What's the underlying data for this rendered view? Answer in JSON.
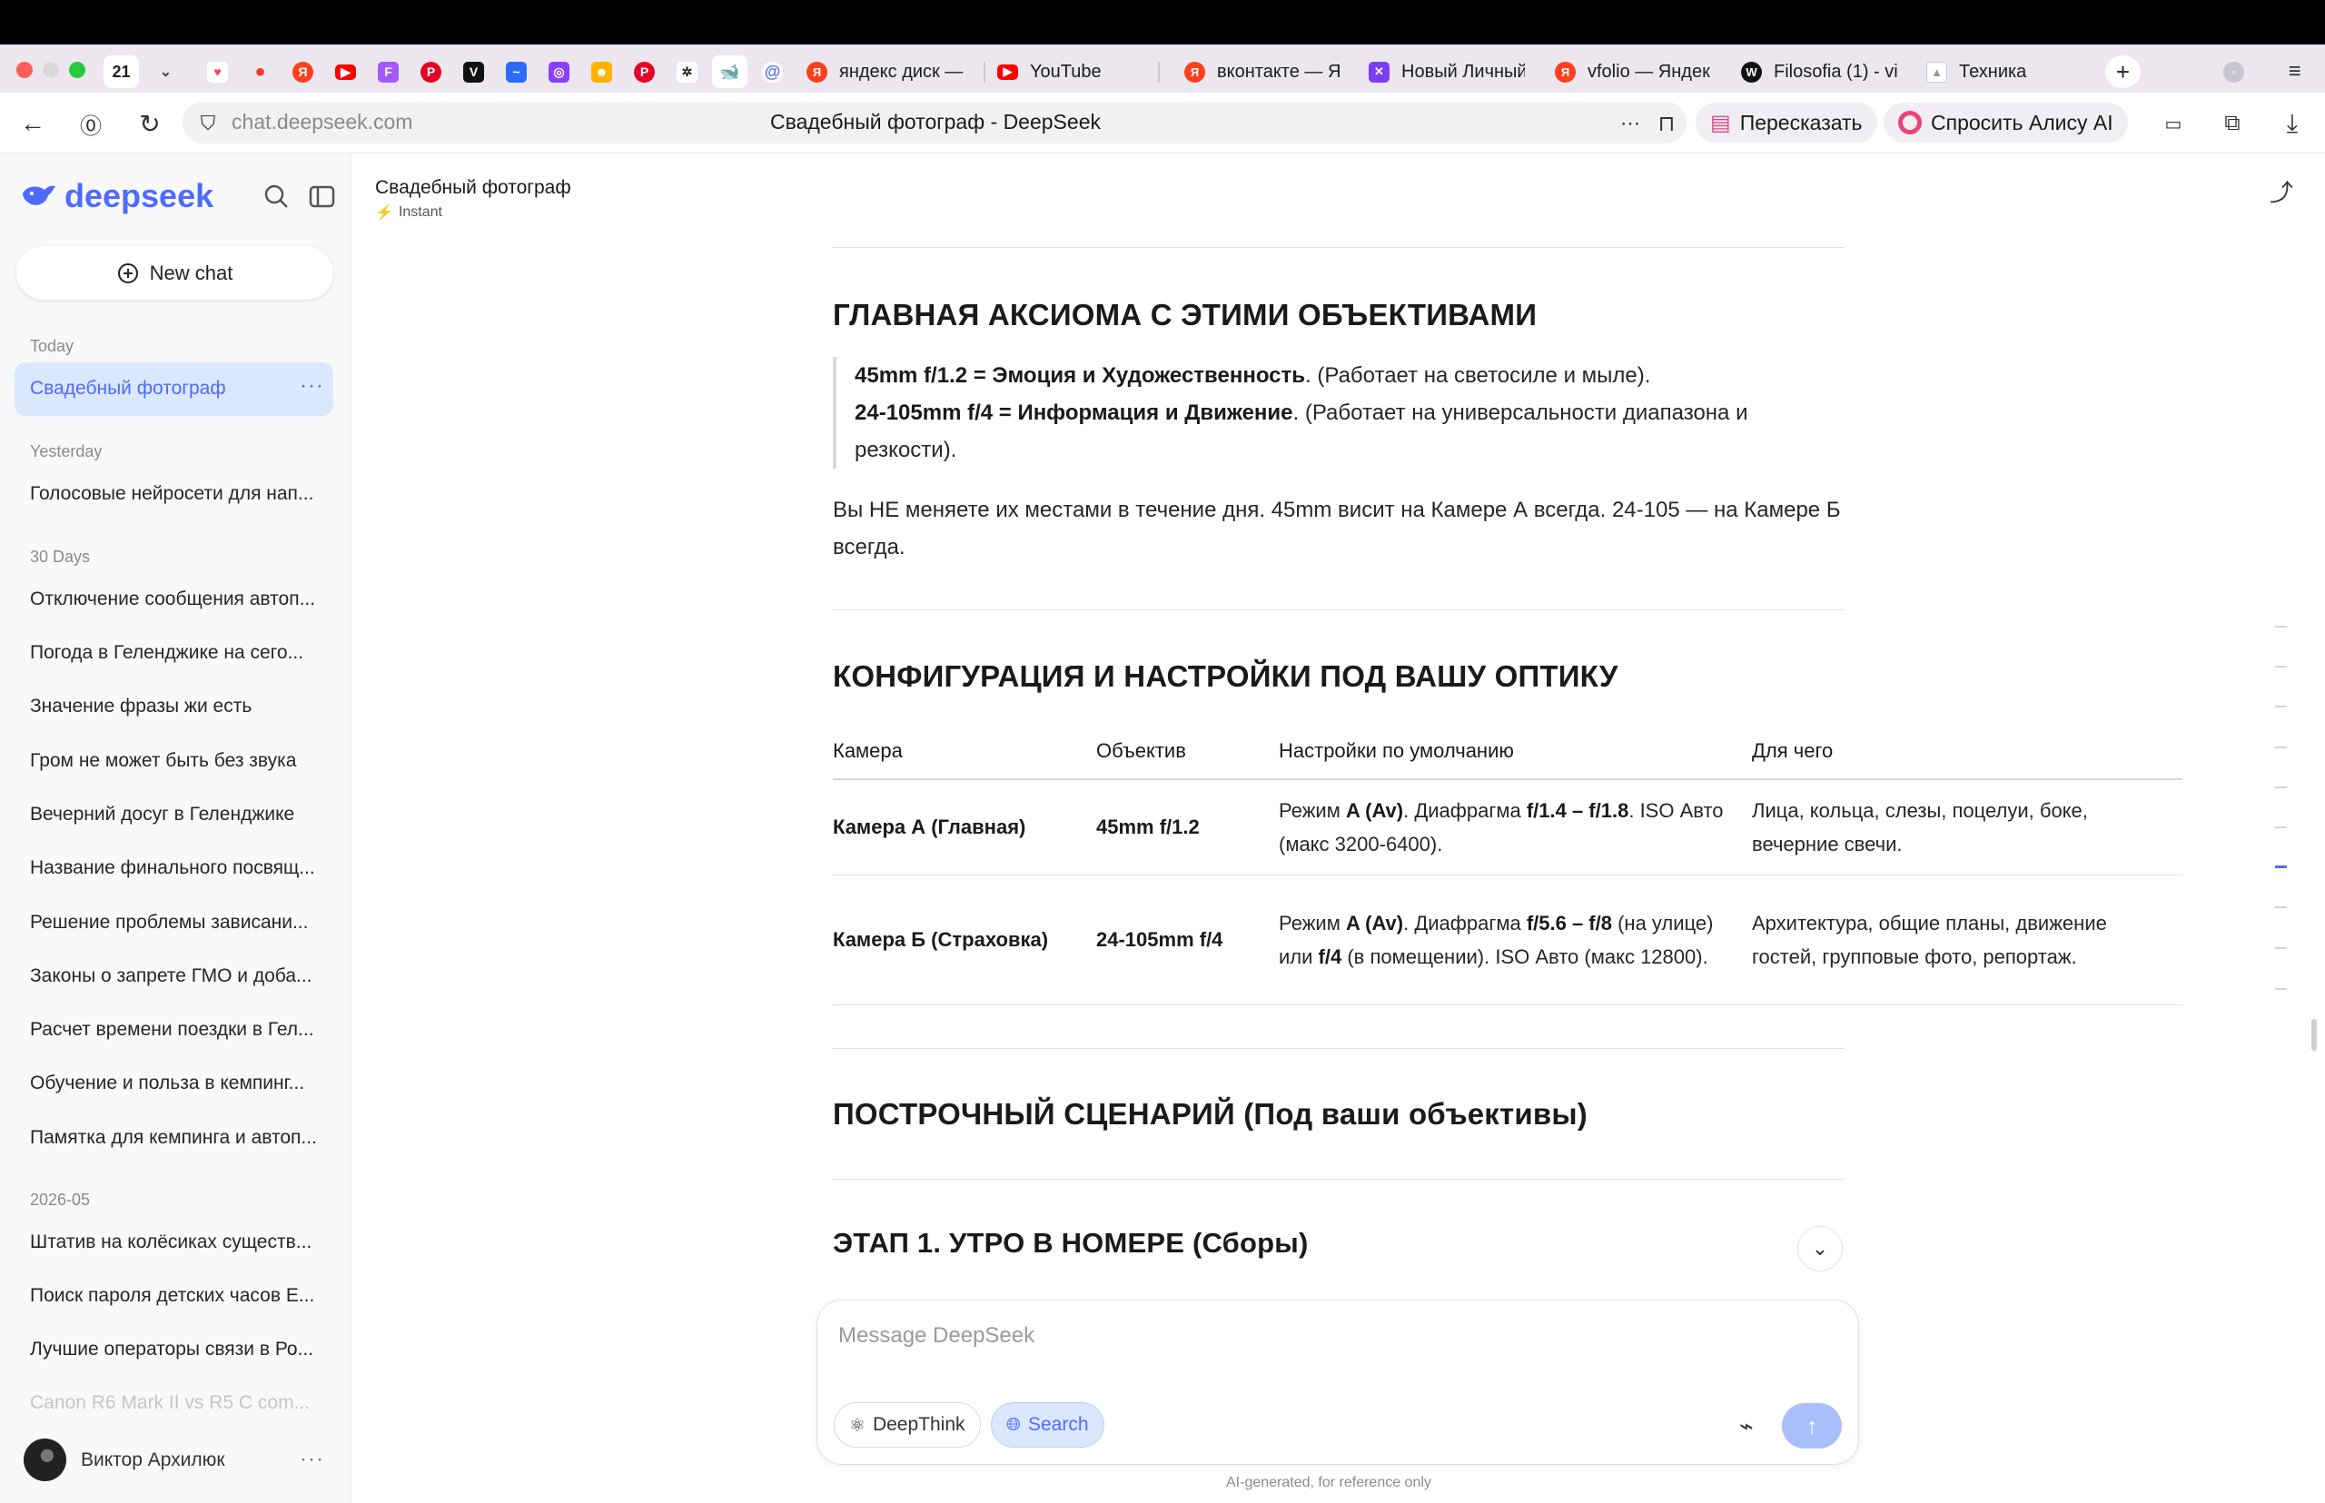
{
  "browser": {
    "tab_counter": "21",
    "url": "chat.deepseek.com",
    "page_title": "Свадебный фотограф - DeepSeek",
    "retell_button": "Пересказать",
    "alice_button": "Спросить Алису AI",
    "tabs": [
      {
        "label": "яндекс диск —",
        "icon": "yandex-icon"
      },
      {
        "label": "YouTube",
        "icon": "youtube-icon"
      },
      {
        "label": "вконтакте — Я",
        "icon": "yandex-icon"
      },
      {
        "label": "Новый Личный",
        "icon": "app-icon"
      },
      {
        "label": "vfolio — Яндекс",
        "icon": "yandex-icon"
      },
      {
        "label": "Filosofia (1) - vi",
        "icon": "w-icon"
      },
      {
        "label": "Техника",
        "icon": "page-icon"
      }
    ]
  },
  "sidebar": {
    "brand": "deepseek",
    "new_chat": "New chat",
    "today_label": "Today",
    "today_items": [
      "Свадебный фотограф"
    ],
    "yesterday_label": "Yesterday",
    "yesterday_items": [
      "Голосовые нейросети для нап..."
    ],
    "days30_label": "30 Days",
    "days30_items": [
      "Отключение сообщения автоп...",
      "Погода в Геленджике на сего...",
      "Значение фразы жи есть",
      "Гром не может быть без звука",
      "Вечерний досуг в Геленджике",
      "Название финального посвящ...",
      "Решение проблемы зависани...",
      "Законы о запрете ГМО и доба...",
      "Расчет времени поездки в Гел...",
      "Обучение и польза в кемпинг...",
      "Памятка для кемпинга и автоп..."
    ],
    "month_label": "2026-05",
    "month_items": [
      "Штатив на колёсиках существ...",
      "Поиск пароля детских часов Е...",
      "Лучшие операторы связи в Ро...",
      "Canon R6 Mark II vs R5 C com..."
    ],
    "user_name": "Виктор Архилюк"
  },
  "chat": {
    "title": "Свадебный фотограф",
    "mode": "Instant",
    "axiom_heading": "ГЛАВНАЯ АКСИОМА С ЭТИМИ ОБЪЕКТИВАМИ",
    "axiom_line1_bold": "45mm f/1.2 = Эмоция и Художественность",
    "axiom_line1_rest": ". (Работает на светосиле и мыле).",
    "axiom_line2_bold": "24-105mm f/4 = Информация и Движение",
    "axiom_line2_rest": ". (Работает на универсальности диапазона и резкости).",
    "axiom_para": "Вы НЕ меняете их местами в течение дня. 45mm висит на Камере А всегда. 24-105 — на Камере Б всегда.",
    "config_heading": "КОНФИГУРАЦИЯ И НАСТРОЙКИ ПОД ВАШУ ОПТИКУ",
    "table": {
      "headers": [
        "Камера",
        "Объектив",
        "Настройки по умолчанию",
        "Для чего"
      ],
      "rows": [
        {
          "camera": "Камера А (Главная)",
          "lens": "45mm f/1.2",
          "s1": "Режим ",
          "s1b": "A (Av)",
          "s2": ". Диафрагма ",
          "s2b": "f/1.4 – f/1.8",
          "s3": ". ISO Авто (макс 3200-6400).",
          "s3b": "",
          "s4": "",
          "purpose": "Лица, кольца, слезы, поцелуи, боке, вечерние свечи."
        },
        {
          "camera": "Камера Б (Страховка)",
          "lens": "24-105mm f/4",
          "s1": "Режим ",
          "s1b": "A (Av)",
          "s2": ". Диафрагма ",
          "s2b": "f/5.6 – f/8",
          "s3": " (на улице) или ",
          "s3b": "f/4",
          "s4": " (в помещении). ISO Авто (макс 12800).",
          "purpose": "Архитектура, общие планы, движение гостей, групповые фото, репортаж."
        }
      ]
    },
    "scenario_heading": "ПОСТРОЧНЫЙ СЦЕНАРИЙ (Под ваши объективы)",
    "stage1_heading": "ЭТАП 1. УТРО В НОМЕРЕ (Сборы)"
  },
  "composer": {
    "placeholder": "Message DeepSeek",
    "deepthink": "DeepThink",
    "search": "Search",
    "footnote": "AI-generated, for reference only"
  },
  "colors": {
    "accent": "#4d6bfe",
    "active_bg": "#dbe7fd"
  }
}
